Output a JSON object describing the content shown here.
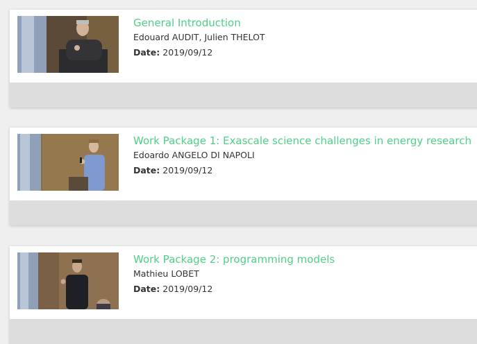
{
  "videos": [
    {
      "title": "General Introduction",
      "authors": "Edouard AUDIT, Julien THELOT",
      "date_label": "Date:",
      "date": "2019/09/12"
    },
    {
      "title": "Work Package 1: Exascale science challenges in energy research",
      "authors": "Edoardo ANGELO DI NAPOLI",
      "date_label": "Date:",
      "date": "2019/09/12"
    },
    {
      "title": "Work Package 2: programming models",
      "authors": "Mathieu LOBET",
      "date_label": "Date:",
      "date": "2019/09/12"
    }
  ],
  "colors": {
    "title": "#4fcf86",
    "card_footer": "#dddddd",
    "background": "#efefef"
  }
}
